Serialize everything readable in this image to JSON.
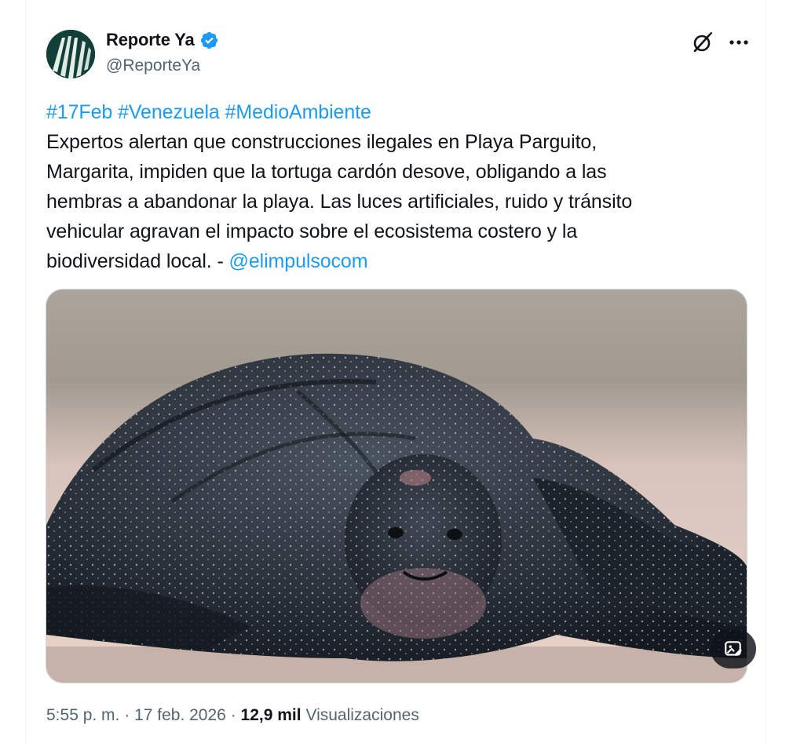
{
  "post": {
    "author_name": "Reporte Ya",
    "handle": "@ReporteYa",
    "hashtags": [
      "#17Feb",
      "#Venezuela",
      "#MedioAmbiente"
    ],
    "text_lines": [
      "Expertos alertan que construcciones ilegales en Playa Parguito,",
      "Margarita, impiden que la tortuga cardón desove, obligando a las",
      "hembras a abandonar la playa. Las luces artificiales, ruido y tránsito",
      "vehicular agravan el impacto sobre el ecosistema costero y la",
      "biodiversidad local. - "
    ],
    "mention": "@elimpulsocom",
    "media_description_icon": "image-description-icon",
    "time": "5:55 p. m.",
    "separator": "·",
    "date": "17 feb. 2026",
    "views_count": "12,9 mil",
    "views_label": "Visualizaciones"
  },
  "icons": {
    "verified": "verified-badge-icon",
    "grok": "grok-icon",
    "more": "more-options-icon"
  },
  "colors": {
    "link": "#1d9bf0",
    "secondary_text": "#536471",
    "verified_badge": "#1d9bf0"
  }
}
